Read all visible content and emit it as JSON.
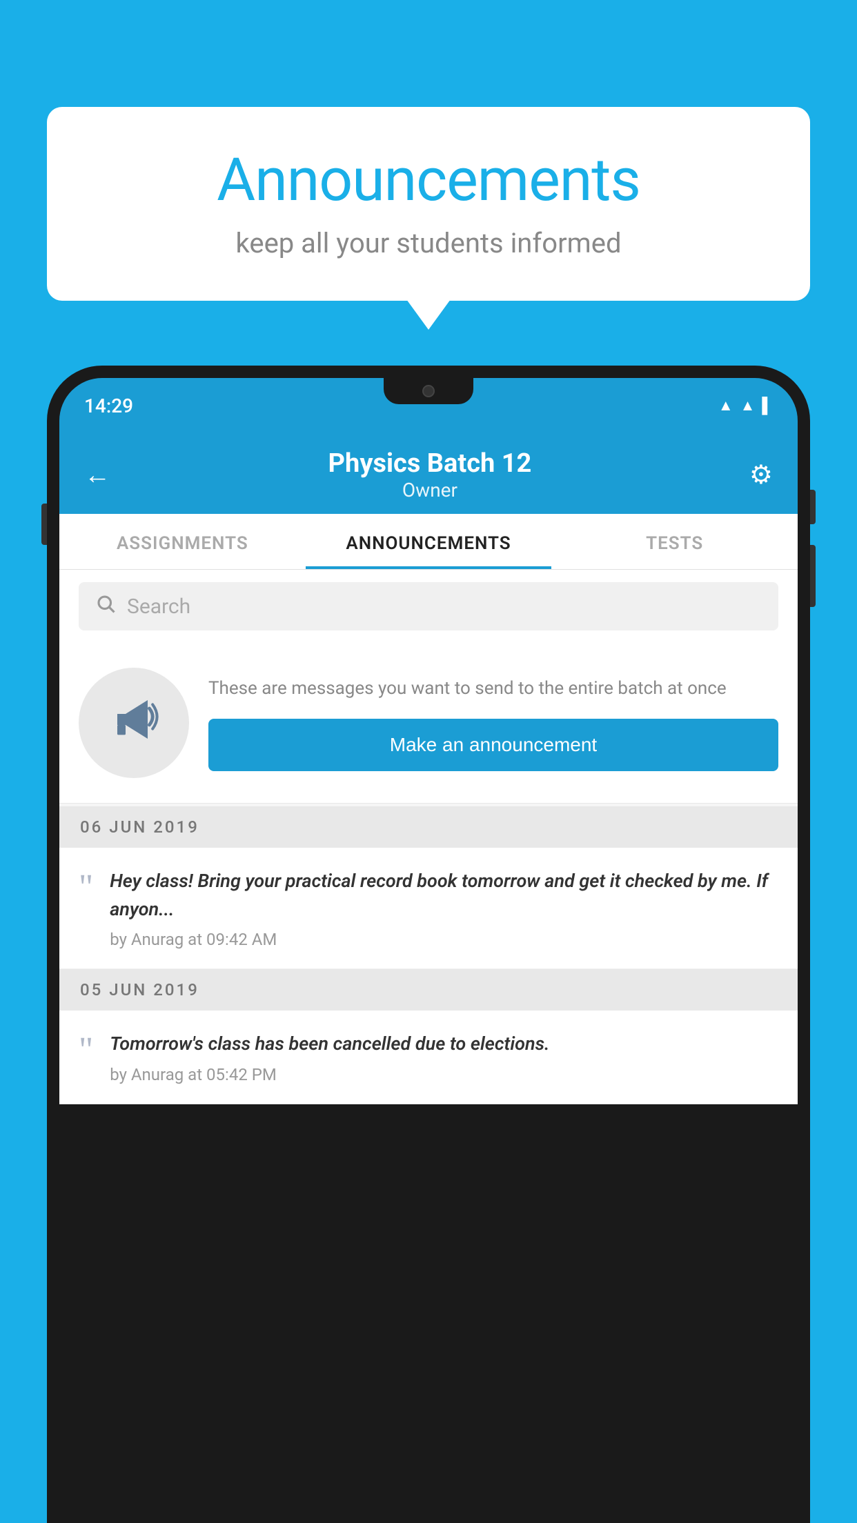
{
  "background_color": "#1AAFE8",
  "speech_bubble": {
    "title": "Announcements",
    "subtitle": "keep all your students informed"
  },
  "status_bar": {
    "time": "14:29",
    "wifi": "▲",
    "signal": "▲",
    "battery": "▌"
  },
  "header": {
    "title": "Physics Batch 12",
    "subtitle": "Owner",
    "back_label": "←",
    "gear_label": "⚙"
  },
  "tabs": [
    {
      "label": "ASSIGNMENTS",
      "active": false
    },
    {
      "label": "ANNOUNCEMENTS",
      "active": true
    },
    {
      "label": "TESTS",
      "active": false
    }
  ],
  "search": {
    "placeholder": "Search"
  },
  "announcement_promo": {
    "description": "These are messages you want to send to the entire batch at once",
    "button_label": "Make an announcement"
  },
  "announcements": [
    {
      "date": "06  JUN  2019",
      "text": "Hey class! Bring your practical record book tomorrow and get it checked by me. If anyon...",
      "meta": "by Anurag at 09:42 AM"
    },
    {
      "date": "05  JUN  2019",
      "text": "Tomorrow's class has been cancelled due to elections.",
      "meta": "by Anurag at 05:42 PM"
    }
  ]
}
